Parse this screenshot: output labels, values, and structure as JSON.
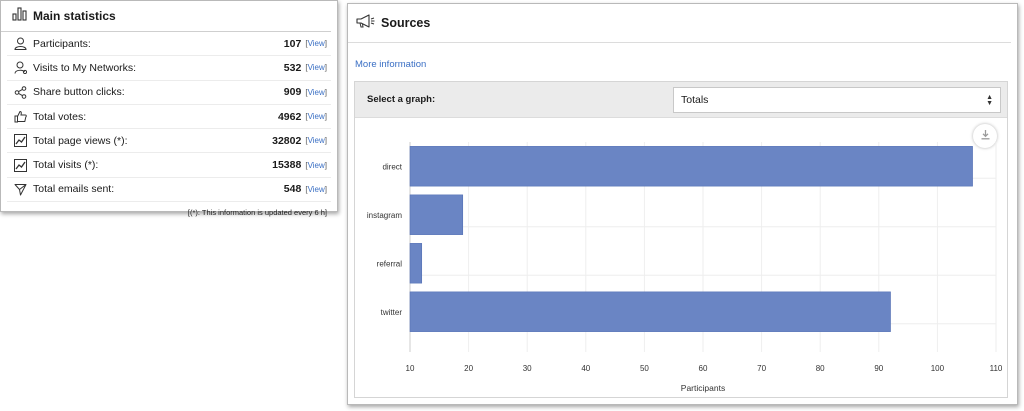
{
  "main_stats": {
    "title": "Main statistics",
    "rows": [
      {
        "icon": "user-icon",
        "label": "Participants:",
        "value": "107",
        "link": "View"
      },
      {
        "icon": "user-network-icon",
        "label": "Visits to My Networks:",
        "value": "532",
        "link": "View"
      },
      {
        "icon": "share-icon",
        "label": "Share button clicks:",
        "value": "909",
        "link": "View"
      },
      {
        "icon": "thumbs-up-icon",
        "label": "Total votes:",
        "value": "4962",
        "link": "View"
      },
      {
        "icon": "line-chart-icon",
        "label": "Total page views (*):",
        "value": "32802",
        "link": "View"
      },
      {
        "icon": "line-chart-icon",
        "label": "Total visits (*):",
        "value": "15388",
        "link": "View"
      },
      {
        "icon": "send-icon",
        "label": "Total emails sent:",
        "value": "548",
        "link": "View"
      }
    ],
    "note": "[(*): This information is updated every 6 h]"
  },
  "sources": {
    "title": "Sources",
    "more_info": "More information",
    "select_label": "Select a graph:",
    "select_value": "Totals"
  },
  "chart_data": {
    "type": "bar",
    "orientation": "horizontal",
    "categories": [
      "direct",
      "instagram",
      "referral",
      "twitter"
    ],
    "values": [
      106,
      19,
      12,
      92
    ],
    "xlabel": "Participants",
    "ylabel": "",
    "xlim": [
      10,
      110
    ],
    "xticks": [
      "10",
      "20",
      "30",
      "40",
      "50",
      "60",
      "70",
      "80",
      "90",
      "100",
      "110"
    ],
    "bar_color": "#6a85c4",
    "grid": true
  }
}
